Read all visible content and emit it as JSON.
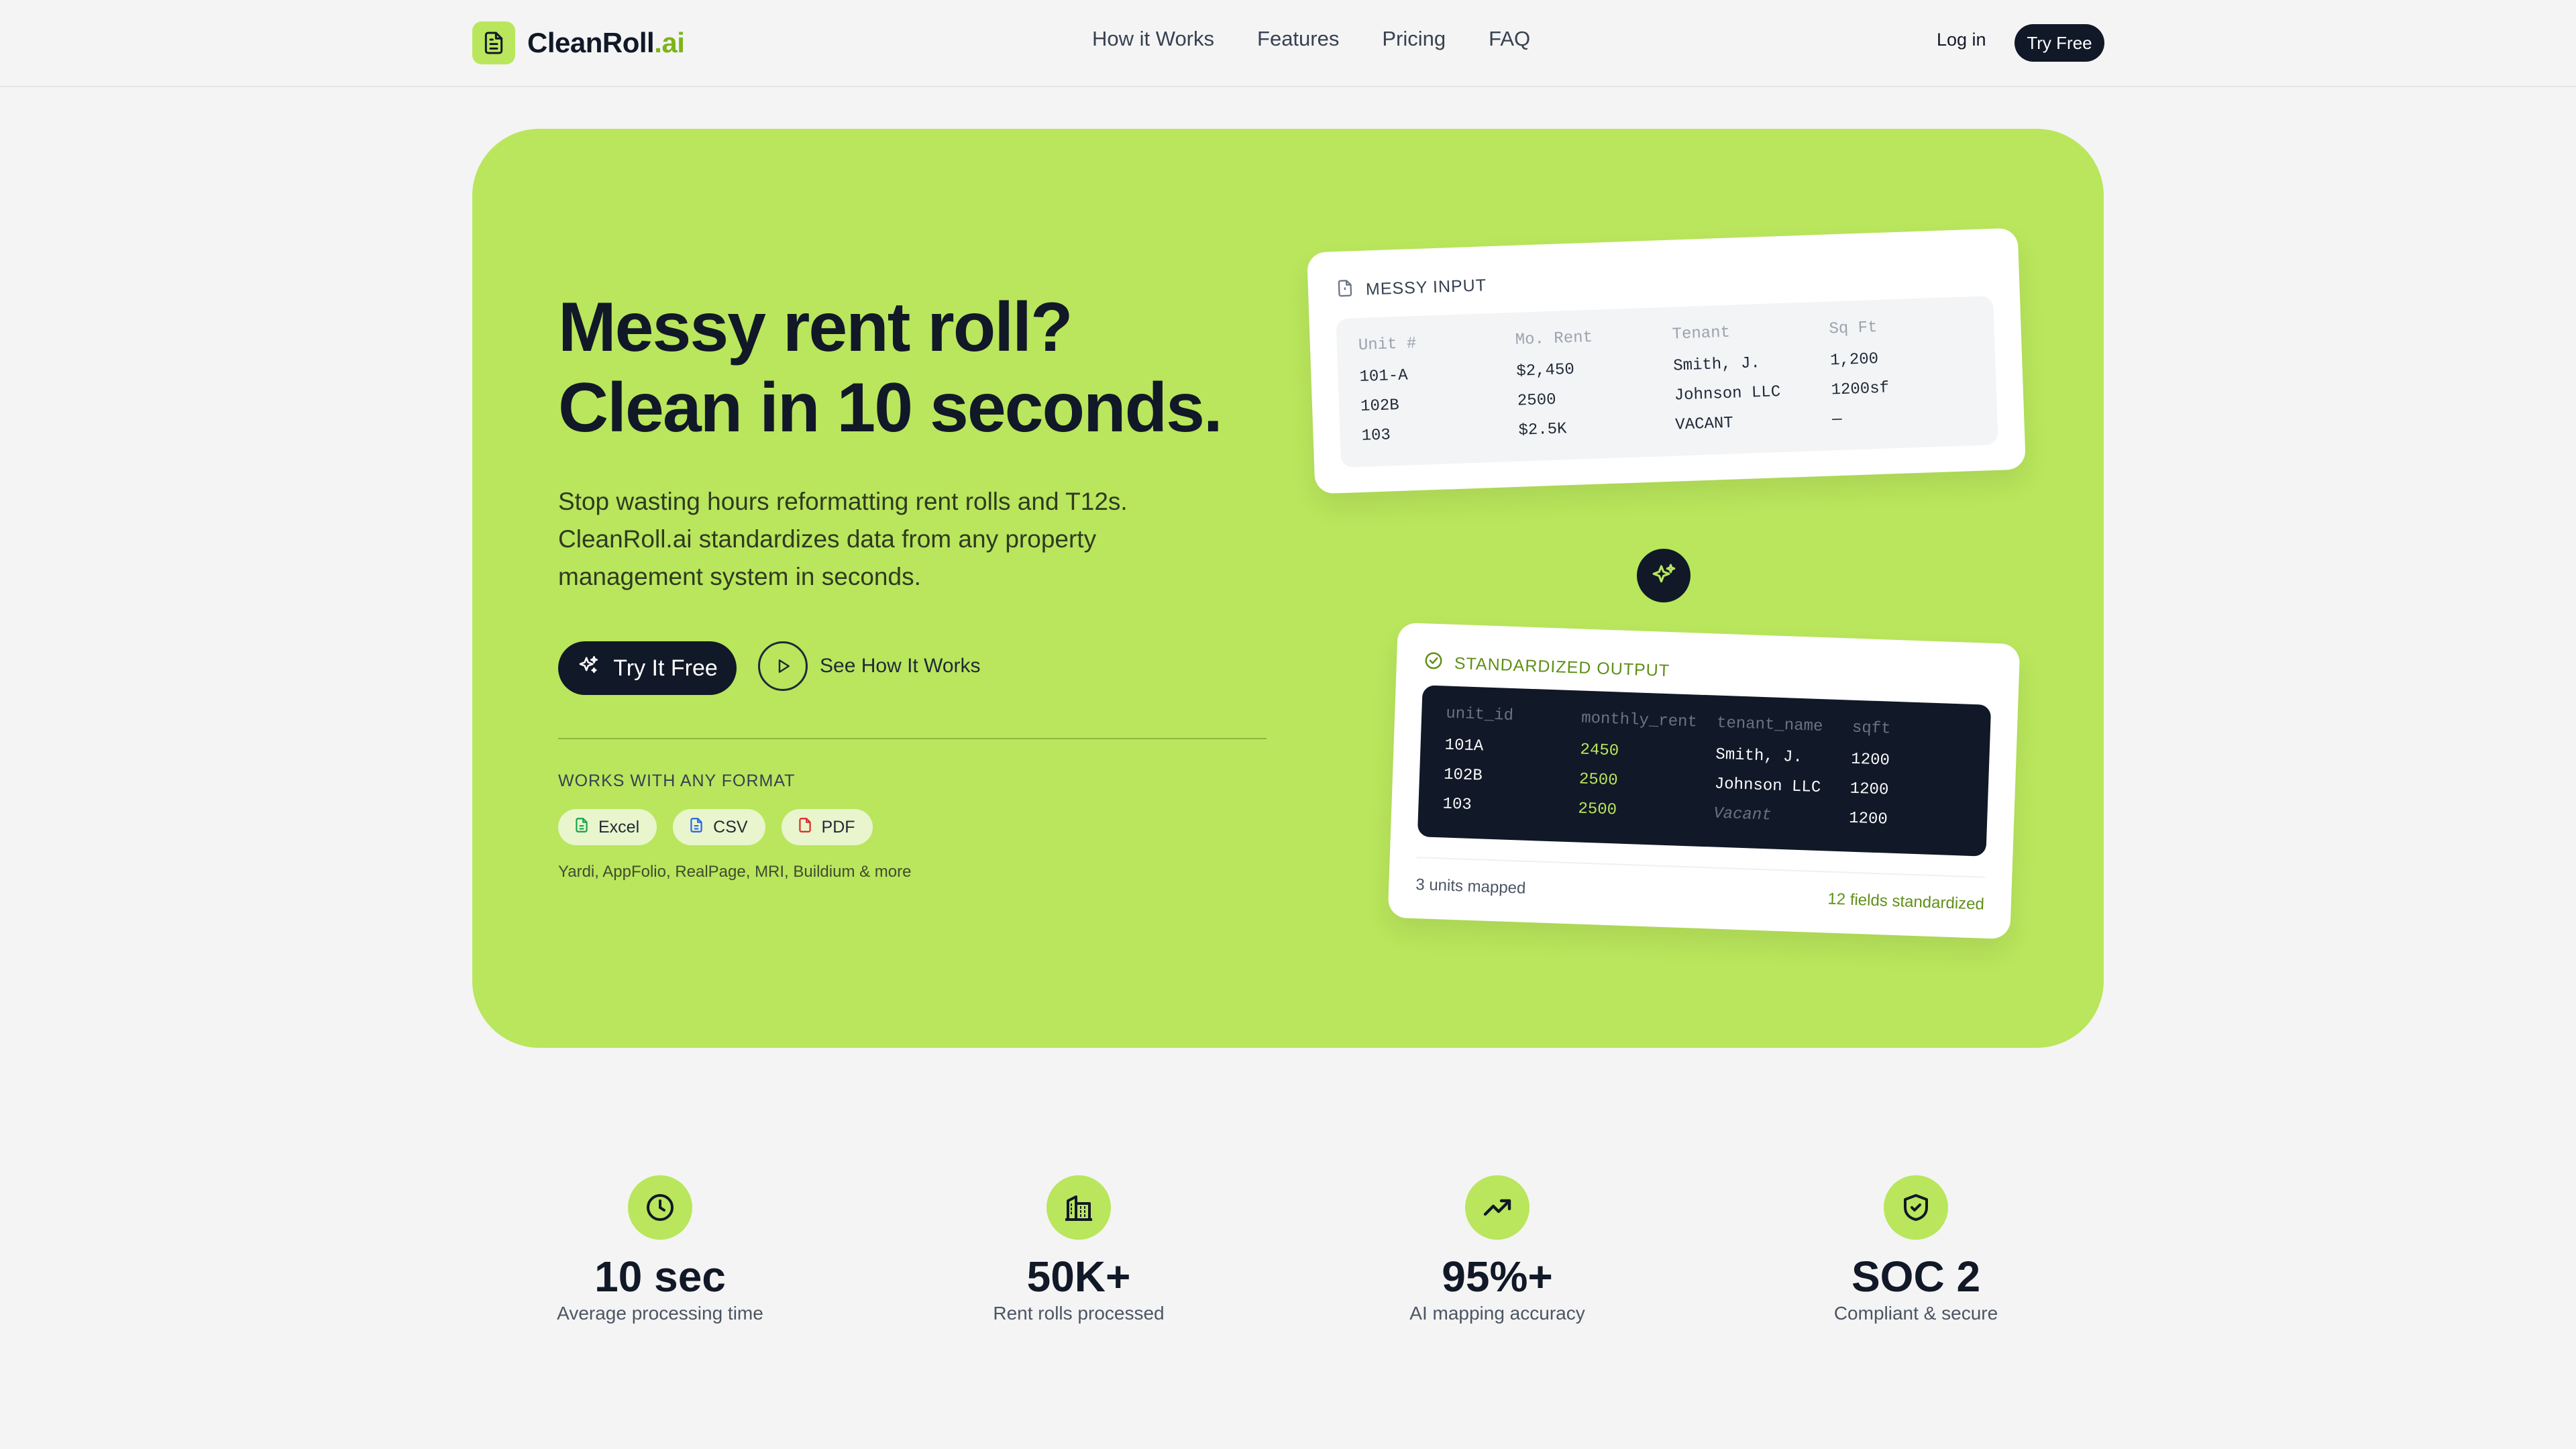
{
  "nav": {
    "brand": "CleanRoll",
    "brand_tld": ".ai",
    "links": [
      "How it Works",
      "Features",
      "Pricing",
      "FAQ"
    ],
    "login": "Log in",
    "cta": "Try Free"
  },
  "hero": {
    "headline_line1": "Messy rent roll?",
    "headline_line2": "Clean in 10 seconds.",
    "subtitle": "Stop wasting hours reformatting rent rolls and T12s. CleanRoll.ai standardizes data from any property management system in seconds.",
    "cta_primary": "Try It Free",
    "cta_secondary": "See How It Works",
    "formats_label": "WORKS WITH ANY FORMAT",
    "formats": [
      {
        "label": "Excel",
        "color": "#16a34a"
      },
      {
        "label": "CSV",
        "color": "#2563eb"
      },
      {
        "label": "PDF",
        "color": "#dc2626"
      }
    ],
    "integrations": "Yardi, AppFolio, RealPage, MRI, Buildium & more"
  },
  "messy_card": {
    "title": "MESSY INPUT",
    "columns": [
      {
        "header": "Unit #",
        "cells": [
          "101-A",
          "102B",
          "103"
        ]
      },
      {
        "header": "Mo. Rent",
        "cells": [
          "$2,450",
          "2500",
          "$2.5K"
        ]
      },
      {
        "header": "Tenant",
        "cells": [
          "Smith, J.",
          "Johnson LLC",
          "VACANT"
        ]
      },
      {
        "header": "Sq Ft",
        "cells": [
          "1,200",
          "1200sf",
          "—"
        ]
      }
    ]
  },
  "clean_card": {
    "title": "STANDARDIZED OUTPUT",
    "columns": [
      {
        "header": "unit_id",
        "cells": [
          "101A",
          "102B",
          "103"
        ]
      },
      {
        "header": "monthly_rent",
        "cells": [
          "2450",
          "2500",
          "2500"
        ]
      },
      {
        "header": "tenant_name",
        "cells": [
          "Smith, J.",
          "Johnson LLC",
          "Vacant"
        ]
      },
      {
        "header": "sqft",
        "cells": [
          "1200",
          "1200",
          "1200"
        ]
      }
    ],
    "footer_left": "3 units mapped",
    "footer_right": "12 fields standardized"
  },
  "stats": [
    {
      "icon": "clock-icon",
      "value": "10 sec",
      "label": "Average processing time"
    },
    {
      "icon": "building-icon",
      "value": "50K+",
      "label": "Rent rolls processed"
    },
    {
      "icon": "trending-up-icon",
      "value": "95%+",
      "label": "AI mapping accuracy"
    },
    {
      "icon": "shield-check-icon",
      "value": "SOC 2",
      "label": "Compliant & secure"
    }
  ],
  "colors": {
    "accent": "#b9e65c",
    "dark": "#111827",
    "background": "#f4f4f4"
  }
}
